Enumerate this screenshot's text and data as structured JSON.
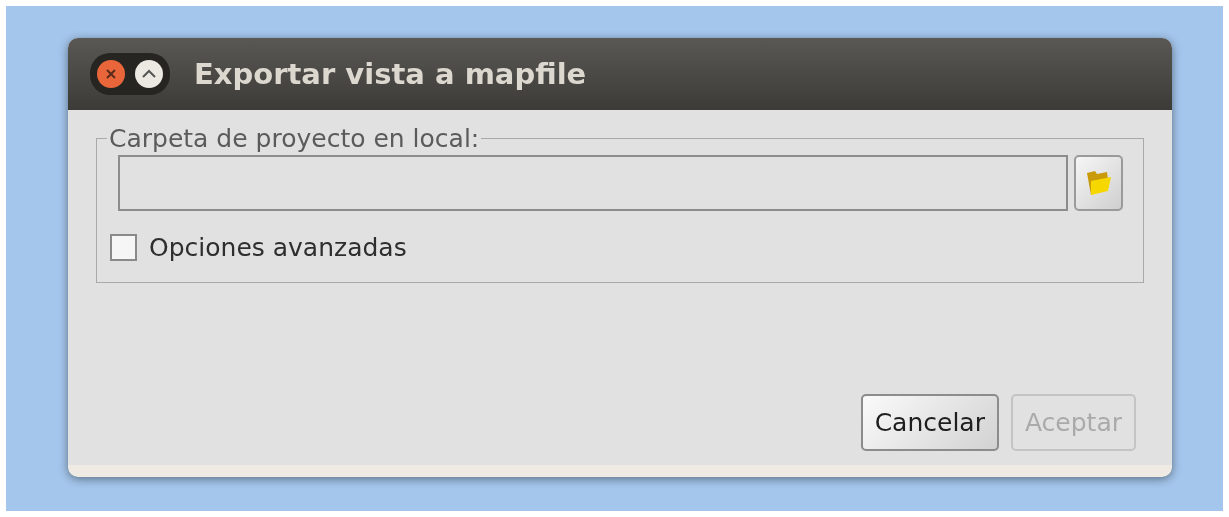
{
  "window": {
    "title": "Exportar vista a mapfile"
  },
  "group": {
    "legend": "Carpeta de proyecto en local:"
  },
  "folder_field": {
    "disabled": false
  },
  "advanced_options": {
    "label": "Opciones avanzadas",
    "checked": false
  },
  "buttons": [
    {
      "label": "Cancelar",
      "disabled": false
    },
    {
      "label": "Aceptar",
      "disabled": true
    }
  ]
}
